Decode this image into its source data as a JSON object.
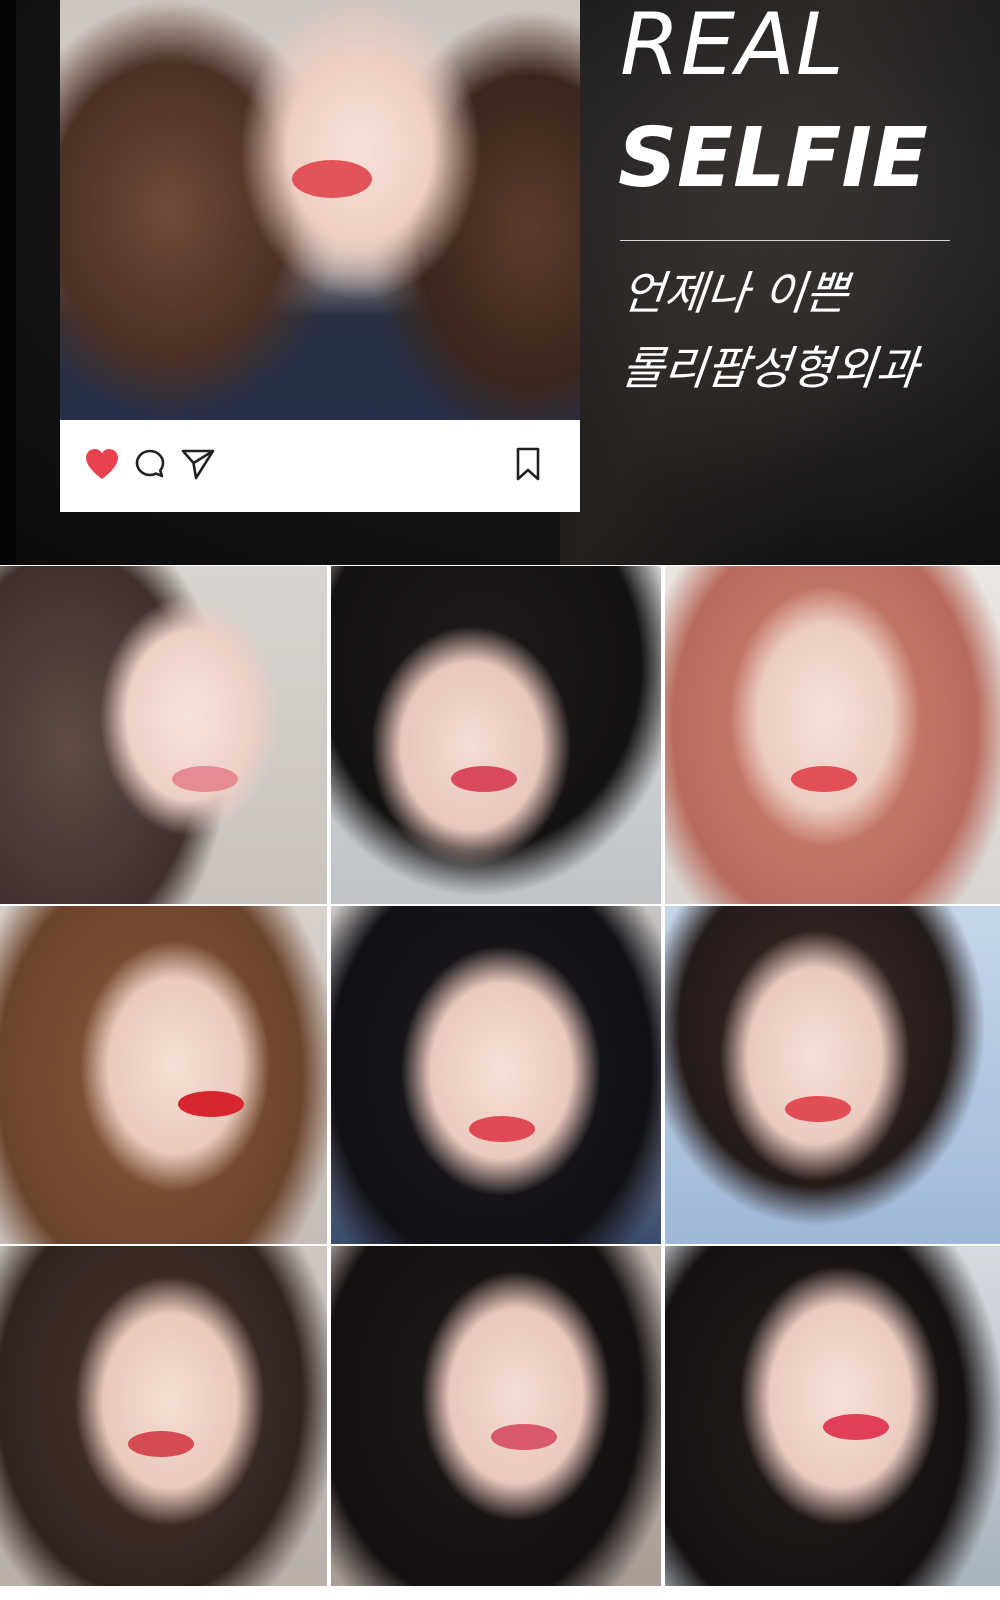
{
  "hero": {
    "title_line1": "REAL",
    "title_line2": "SELFIE",
    "subtitle_line1": "언제나 이쁜",
    "subtitle_line2": "롤리팝성형외과"
  },
  "post_actions": {
    "icons": [
      "heart-icon",
      "comment-icon",
      "send-icon",
      "bookmark-icon"
    ],
    "heart_color": "#e8424e"
  },
  "gallery": {
    "photos": [
      {
        "hair": "brown-wavy"
      },
      {
        "hair": "black-bangs"
      },
      {
        "hair": "pink-straight"
      },
      {
        "hair": "brown-long"
      },
      {
        "hair": "black-wavy"
      },
      {
        "hair": "black-bob"
      },
      {
        "hair": "brown-bangs"
      },
      {
        "hair": "black-long"
      },
      {
        "hair": "black-straight"
      }
    ]
  },
  "colors": {
    "hero_background": "#161515",
    "text": "#ffffff",
    "lip": "#e2545a"
  }
}
